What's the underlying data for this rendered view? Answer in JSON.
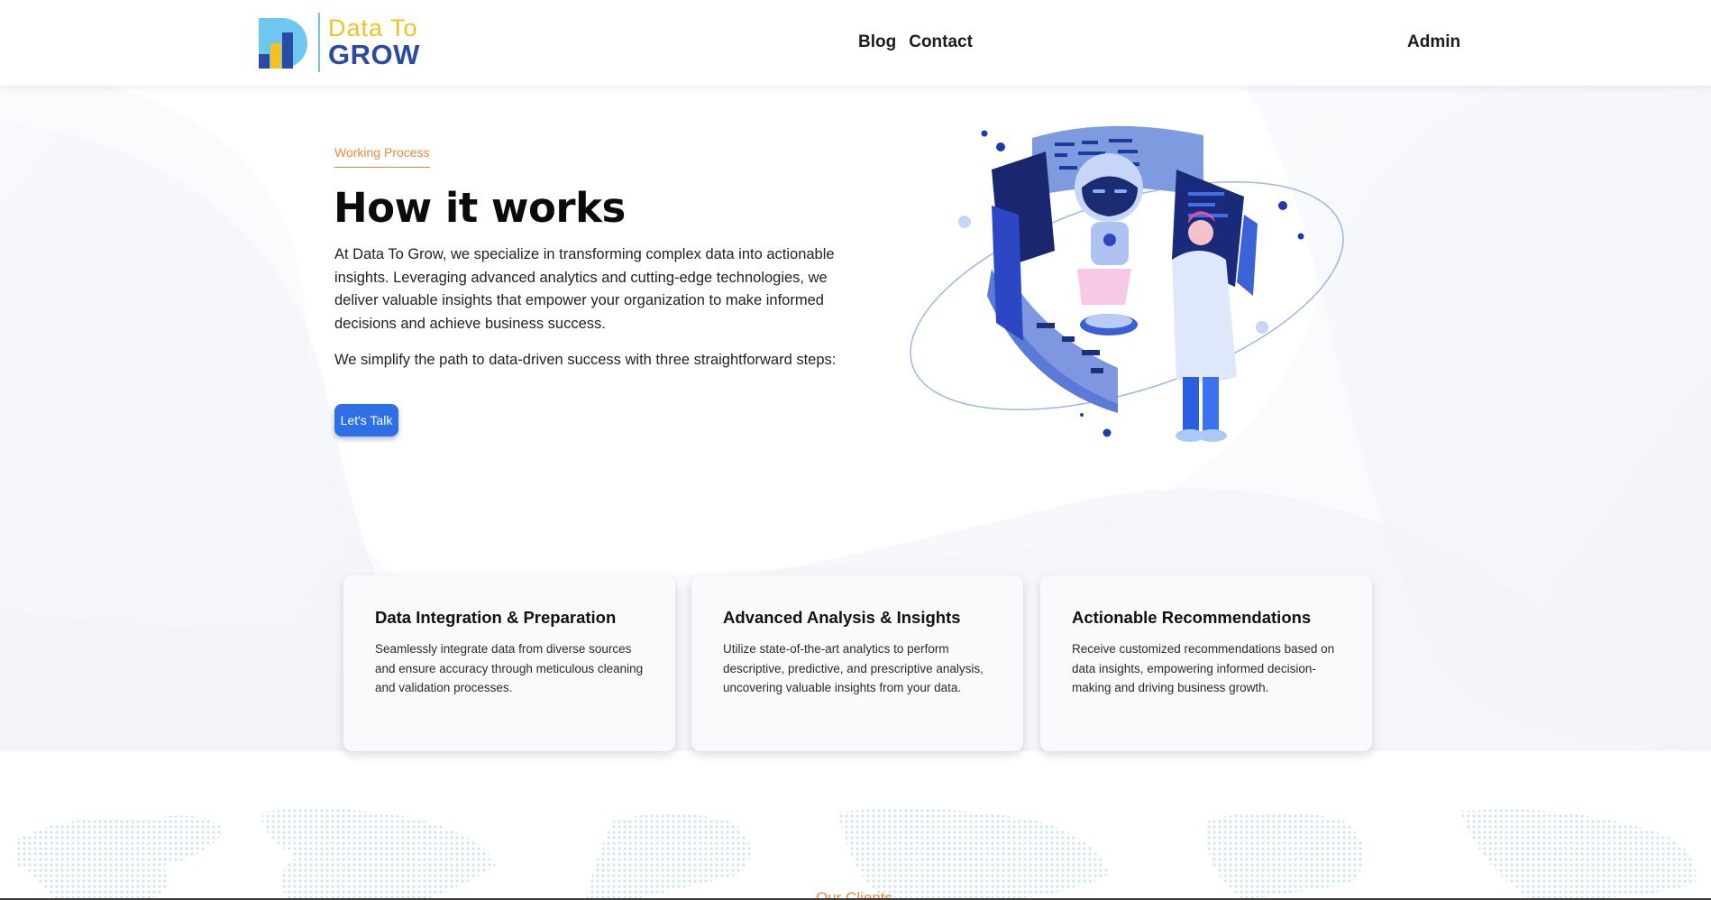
{
  "header": {
    "logo": {
      "line1": "Data To",
      "line2": "GROW"
    },
    "nav": [
      {
        "label": "Blog"
      },
      {
        "label": "Contact"
      }
    ],
    "admin_label": "Admin"
  },
  "hero": {
    "eyebrow": "Working Process",
    "title": "How it works",
    "description": "At Data To Grow, we specialize in transforming complex data into actionable insights. Leveraging advanced analytics and cutting-edge technologies, we deliver valuable insights that empower your organization to make informed decisions and achieve business success.",
    "steps_intro": "We simplify the path to data-driven success with three straightforward steps:",
    "cta_label": "Let's Talk"
  },
  "cards": [
    {
      "title": "Data Integration & Preparation",
      "text": "Seamlessly integrate data from diverse sources and ensure accuracy through meticulous cleaning and validation processes."
    },
    {
      "title": "Advanced Analysis & Insights",
      "text": "Utilize state-of-the-art analytics to perform descriptive, predictive, and prescriptive analysis, uncovering valuable insights from your data."
    },
    {
      "title": "Actionable Recommendations",
      "text": "Receive customized recommendations based on data insights, empowering informed decision-making and driving business growth."
    }
  ],
  "clients": {
    "heading": "Our Clients"
  },
  "colors": {
    "accent_orange": "#f0883a",
    "primary_blue": "#2f6fe6",
    "logo_yellow": "#f2c224",
    "logo_navy": "#2a4aa3"
  }
}
